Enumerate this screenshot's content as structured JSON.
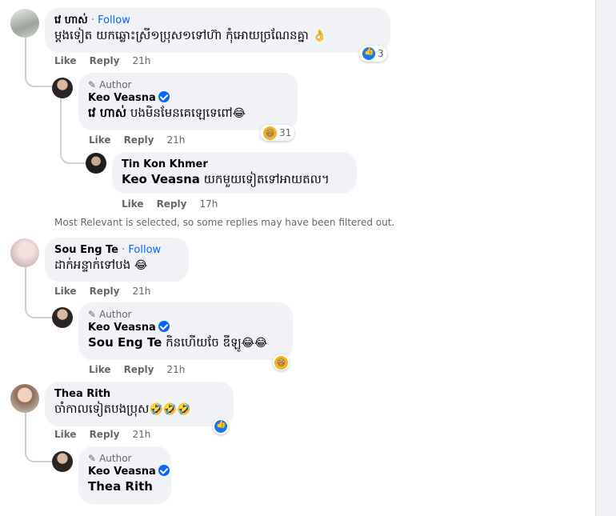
{
  "comments": [
    {
      "name": "វេ ហាស់",
      "follow_sep": " · ",
      "follow": "Follow",
      "text": "ម្ដងទៀត យកឆ្លោះស្រី១ប្រុស១ទៅហ៊ា កុំអោយច្រណែនគ្នា",
      "text_emoji": "👌",
      "reaction_count": "3",
      "like": "Like",
      "reply": "Reply",
      "time": "21h",
      "replies": [
        {
          "author_label": "Author",
          "name": "Keo Veasna",
          "mention": "វេ ហាស់",
          "text": " បងមិនមែនគេឡេទេពៅ",
          "text_emoji": "😂",
          "reaction_count": "31",
          "like": "Like",
          "reply": "Reply",
          "time": "21h"
        },
        {
          "name": "Tin Kon Khmer",
          "mention": "Keo Veasna",
          "text": " យកមួយទៀតទៅអាយតល។",
          "like": "Like",
          "reply": "Reply",
          "time": "17h"
        }
      ]
    },
    {
      "name": "Sou Eng Te",
      "follow_sep": " · ",
      "follow": "Follow",
      "text": "ដាក់អន្ទាក់ទៅបង",
      "text_emoji": "😂",
      "like": "Like",
      "reply": "Reply",
      "time": "21h",
      "replies": [
        {
          "author_label": "Author",
          "name": "Keo Veasna",
          "mention": "Sou Eng Te",
          "text": " កិនហើយចែ ឌីឡូ",
          "text_emoji": "😂😂",
          "like": "Like",
          "reply": "Reply",
          "time": "21h"
        }
      ]
    },
    {
      "name": "Thea Rith",
      "text": "ចាំកាលទៀតបងប្រុស",
      "text_emoji": "🤣🤣🤣",
      "like": "Like",
      "reply": "Reply",
      "time": "21h",
      "replies": [
        {
          "author_label": "Author",
          "name": "Keo Veasna",
          "mention": "Thea Rith",
          "text": ""
        }
      ]
    }
  ],
  "notice": "Most Relevant is selected, so some replies may have been filtered out."
}
